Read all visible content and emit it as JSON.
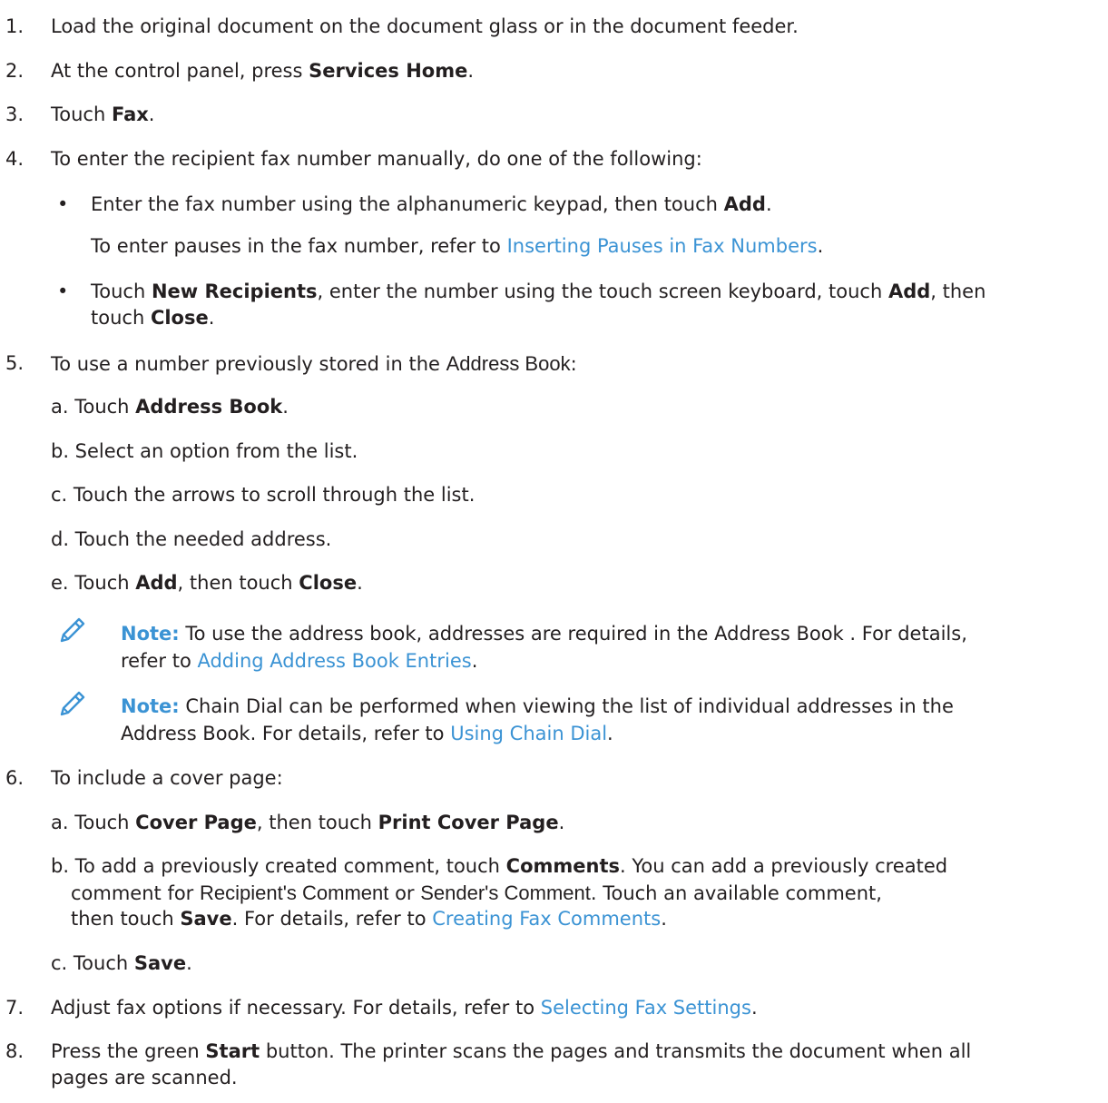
{
  "steps": {
    "s1": {
      "num": "1.",
      "text": "Load the original document on the document glass or in the document feeder."
    },
    "s2": {
      "num": "2.",
      "pre": "At the control panel, press ",
      "bold": "Services Home",
      "post": "."
    },
    "s3": {
      "num": "3.",
      "pre": "Touch ",
      "bold": "Fax",
      "post": "."
    },
    "s4": {
      "num": "4.",
      "text": "To enter the recipient fax number manually, do one of the following:",
      "b1": {
        "pre": "Enter the fax number using the alphanumeric keypad, then touch ",
        "bold": "Add",
        "post": "."
      },
      "b1_note": {
        "pre": "To enter pauses in the fax number, refer to ",
        "link": "Inserting Pauses in Fax Numbers",
        "post": "."
      },
      "b2": {
        "pre": "Touch ",
        "bold1": "New Recipients",
        "mid": ", enter the number using the touch screen keyboard, touch ",
        "bold2": "Add",
        "end": ", then",
        "line2_pre": "touch ",
        "line2_bold": "Close",
        "line2_post": "."
      }
    },
    "s5": {
      "num": "5.",
      "pre": "To use a number previously stored in the ",
      "emph": "Address Book",
      "post": ":",
      "a": {
        "pre": "a. Touch ",
        "bold": "Address Book",
        "post": "."
      },
      "b": "b. Select an option from the list.",
      "c": "c. Touch the arrows to scroll through the list.",
      "d": "d. Touch the needed address.",
      "e": {
        "pre": "e. Touch ",
        "bold1": "Add",
        "mid": ", then touch ",
        "bold2": "Close",
        "post": "."
      },
      "note1": {
        "label": "Note:",
        "line1": " To use the address book, addresses are required in the Address Book . For details,",
        "line2_pre": "refer to ",
        "link": "Adding Address Book Entries",
        "post": "."
      },
      "note2": {
        "label": "Note:",
        "line1": " Chain Dial can be performed when viewing the list of individual addresses in the",
        "line2_pre": "Address Book. For details, refer to ",
        "link": "Using Chain Dial",
        "post": "."
      }
    },
    "s6": {
      "num": "6.",
      "text": "To include a cover page:",
      "a": {
        "pre": "a. Touch ",
        "bold1": "Cover Page",
        "mid": ", then touch ",
        "bold2": "Print Cover Page",
        "post": "."
      },
      "b": {
        "pre": "b. To add a previously created comment, touch ",
        "bold": "Comments",
        "post": ". You can add a previously created",
        "line2_pre": "comment for ",
        "emph1": "Recipient's Comment",
        "line2_mid": " or ",
        "emph2": "Sender's Comment",
        "line2_post": ". Touch an available comment,",
        "line3_pre": "then touch ",
        "line3_bold": "Save",
        "line3_mid": ". For details, refer to ",
        "link": "Creating Fax Comments",
        "line3_post": "."
      },
      "c": {
        "pre": "c. Touch ",
        "bold": "Save",
        "post": "."
      }
    },
    "s7": {
      "num": "7.",
      "pre": "Adjust fax options if necessary. For details, refer to ",
      "link": "Selecting Fax Settings",
      "post": "."
    },
    "s8": {
      "num": "8.",
      "pre": "Press the green ",
      "bold": "Start",
      "post": " button. The printer scans the pages and transmits the document when all",
      "line2": "pages are scanned."
    }
  },
  "colors": {
    "text": "#231f20",
    "link": "#3b93d4"
  },
  "icons": {
    "note": "pencil-icon"
  }
}
